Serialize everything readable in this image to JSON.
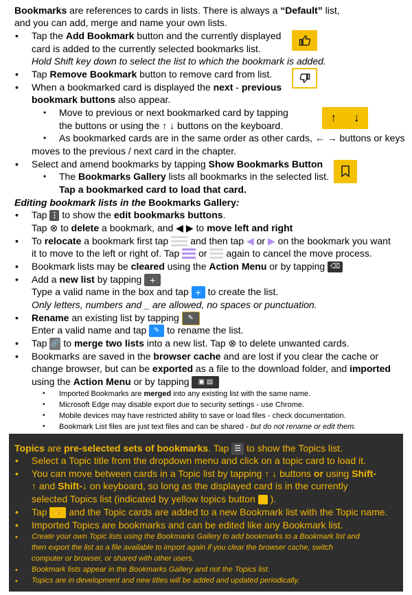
{
  "intro": {
    "l1a": "Bookmarks",
    "l1b": " are references to cards in lists. There is always a ",
    "l1c": "“Default”",
    "l1d": " list,",
    "l2": "and you can add, merge and name your own lists."
  },
  "add": {
    "a1": "Tap the ",
    "a2": "Add Bookmark",
    "a3": " button and the currently displayed",
    "a4": "card is added to the currently selected bookmarks list.",
    "a5": "Hold Shift key down to select the list to which the bookmark is added."
  },
  "remove": {
    "a1": "Tap ",
    "a2": "Remove Bookmark",
    "a3": " button to remove card from list."
  },
  "nextprev": {
    "a1": "When a bookmarked card is displayed the ",
    "a2": "next",
    "a3": " - ",
    "a4": "previous",
    "a5": "bookmark buttons",
    "a6": " also appear.",
    "s1a": "Move to previous or next bookmarked card by tapping",
    "s1b": "the buttons or using the ↑ ↓ buttons on the keyboard.",
    "s2a": "As bookmarked cards are in the same order as other cards, ← → buttons or keys",
    "s2b": "moves to the previous / next card in the chapter."
  },
  "show": {
    "a1": "Select and amend bookmarks by tapping ",
    "a2": "Show Bookmarks Button",
    "s1": "The ",
    "s2": "Bookmarks Gallery",
    "s3": " lists all bookmarks in the selected list.",
    "s4": "Tap a bookmarked card to load that card."
  },
  "editing": {
    "h1": "Editing bookmark lists in the ",
    "h2": "Bookmarks Gallery",
    "h3": ":",
    "b1a": "Tap ",
    "b1b": " to show the ",
    "b1c": "edit bookmarks buttons",
    "b1d": ".",
    "b1e": "Tap ⊗ to ",
    "b1f": "delete",
    "b1g": " a bookmark, and ◀ ▶ to ",
    "b1h": "move left and right",
    "b2a": "To ",
    "b2b": "relocate",
    "b2c": " a bookmark first tap",
    "b2d": "and then tap",
    "b2e": "or",
    "b2f": "on the bookmark you want",
    "b2g": "it to move to the left or right of. Tap",
    "b2h": "or",
    "b2i": "again to cancel the move process.",
    "b3a": "Bookmark lists may be ",
    "b3b": "cleared",
    "b3c": " using the ",
    "b3d": "Action Menu",
    "b3e": " or by tapping",
    "b4a": "Add a ",
    "b4b": "new list",
    "b4c": " by tapping",
    "b4d": "Type a valid name in the box and tap",
    "b4e": "to create the list.",
    "b4f": "Only letters, numbers and _ are allowed, no spaces or punctuation.",
    "b5a": "Rename",
    "b5b": " an existing list by tapping",
    "b5c": "Enter a valid name and  tap",
    "b5d": "to rename the list.",
    "b6a": "Tap",
    "b6b": "to ",
    "b6c": "merge two lists",
    "b6d": " into a new list. Tap ⊗ to delete unwanted cards.",
    "b7a": "Bookmarks are saved in the ",
    "b7b": "browser cache",
    "b7c": " and are lost if you clear the cache or",
    "b7d": "change browser, but can be ",
    "b7e": "exported",
    "b7f": " as a file to the download folder, and ",
    "b7g": "imported",
    "b7h": "using the ",
    "b7i": "Action Menu",
    "b7j": " or by tapping",
    "n1a": "Imported Bookmarks are ",
    "n1b": "merged",
    "n1c": " into any existing list with the same name.",
    "n2": "Microsoft Edge may disable export due to security settings - use Chrome.",
    "n3": "Mobile devices may have restricted ability to save or load files - check documentation.",
    "n4a": "Bookmark List files are just text files and can be shared - ",
    "n4b": "but do not rename or edit them."
  },
  "topics": {
    "h1": "Topics",
    "h2": " are ",
    "h3": "pre-selected sets of bookmarks",
    "h4": ". Tap",
    "h5": "to show the Topics list.",
    "t1": "Select a Topic title from the dropdown menu and click on a topic card to load it.",
    "t2a": "You can move between cards in a Topic list by tapping ",
    "t2b": "↑ ↓",
    "t2c": " buttons ",
    "t2d": "or",
    "t2e": "  using ",
    "t2f": "Shift-",
    "t2g": "↑",
    "t2h": " and ",
    "t2i": "Shift-↓",
    "t2j": " on keyboard, so long as the displayed card is in the currently",
    "t2k": "selected Topics list (indicated by yellow topics button",
    "t2l": ").",
    "t3a": "Tap",
    "t3b": "and the Topic cards are added to a new Bookmark list with the Topic name.",
    "t4": "Imported Topics are bookmarks and can be edited like any Bookmark list.",
    "t5a": "Create your own Topic lists using the Bookmarks Gallery to add bookmarks to a Bookmark list and",
    "t5b": "then export the list as a file available to import again if you clear the browser cache, switch",
    "t5c": "computer or browser, or shared with other users.",
    "t6": "Bookmark lists appear in the Bookmarks Gallery and not the Topics list.",
    "t7": "Topics are in development and new titles will be added and updated periodically."
  },
  "icons": {
    "thumbs_up": "thumbs-up-icon",
    "thumbs_down": "thumbs-down-icon",
    "arrows": "up-down-arrows-icon",
    "bookmark": "bookmark-icon",
    "kebab": "kebab-menu-icon",
    "lines": "lines-icon",
    "triangles": "purple-triangle-icon",
    "clear": "clear-icon",
    "plus": "plus-icon",
    "rename": "rename-icon",
    "merge": "merge-icon",
    "save": "save-icon",
    "load": "load-icon",
    "topics": "topics-stack-icon"
  },
  "colors": {
    "yellow": "#f5c000",
    "dark_panel": "#2e2e2e",
    "topics_text": "#f2b705",
    "purple": "#b48ef0",
    "blue": "#1f8fff"
  }
}
